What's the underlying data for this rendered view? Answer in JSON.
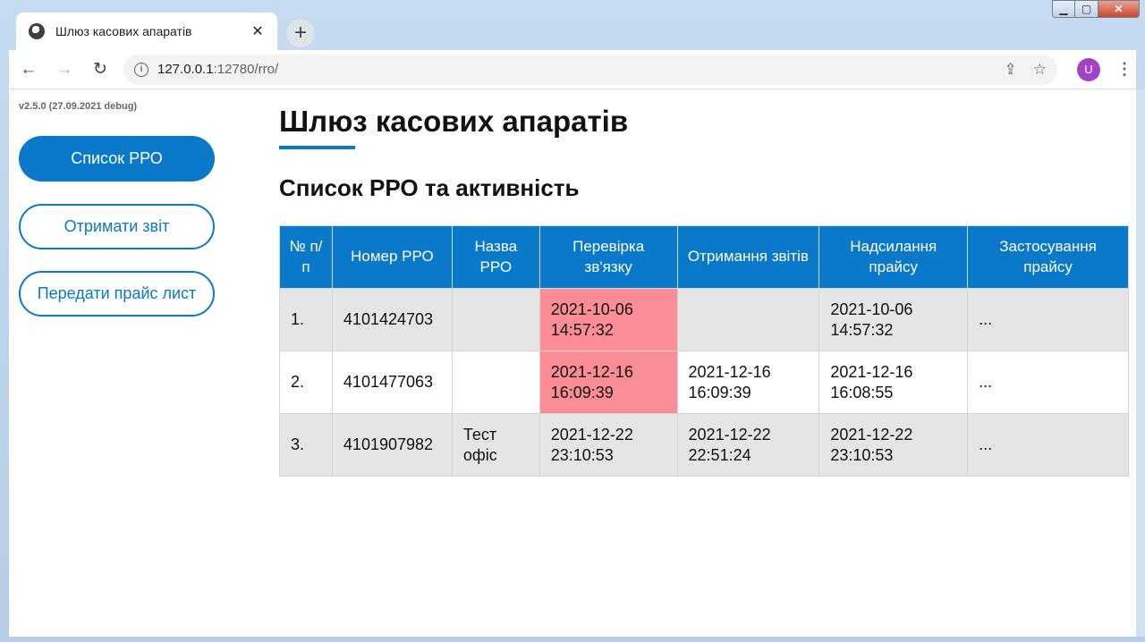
{
  "browser": {
    "tab_title": "Шлюз касових апаратів",
    "tab_close": "✕",
    "new_tab": "+",
    "url_host": "127.0.0.1",
    "url_rest": ":12780/rro/"
  },
  "sidebar": {
    "version": "v2.5.0 (27.09.2021 debug)",
    "buttons": [
      "Список РРО",
      "Отримати звіт",
      "Передати прайс лист"
    ]
  },
  "main": {
    "title": "Шлюз касових апаратів",
    "subtitle": "Список РРО та активність",
    "columns": [
      "№ п/п",
      "Номер РРО",
      "Назва РРО",
      "Перевірка зв'язку",
      "Отримання звітів",
      "Надсилання прайсу",
      "Застосування прайсу"
    ],
    "rows": [
      {
        "num": "1.",
        "rro": "4101424703",
        "name": "",
        "check": "2021-10-06 14:57:32",
        "reports": "",
        "send_price": "2021-10-06 14:57:32",
        "apply_price": "..."
      },
      {
        "num": "2.",
        "rro": "4101477063",
        "name": "",
        "check": "2021-12-16 16:09:39",
        "reports": "2021-12-16 16:09:39",
        "send_price": "2021-12-16 16:08:55",
        "apply_price": "..."
      },
      {
        "num": "3.",
        "rro": "4101907982",
        "name": "Тест офіс",
        "check": "2021-12-22 23:10:53",
        "reports": "2021-12-22 22:51:24",
        "send_price": "2021-12-22 23:10:53",
        "apply_price": "..."
      }
    ],
    "alert_color": "#fa8d96",
    "accent_color": "#0a79c9"
  }
}
